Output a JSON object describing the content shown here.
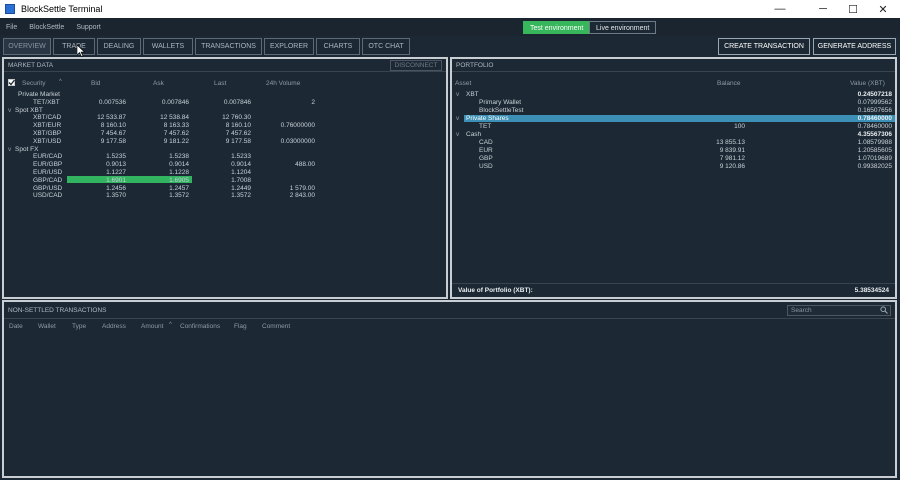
{
  "window": {
    "title": "BlockSettle Terminal",
    "min_glyph": "─",
    "max_glyph": "☐",
    "close_glyph": "✕",
    "dash_glyph": "—"
  },
  "menu": [
    "File",
    "BlockSettle",
    "Support"
  ],
  "environment": {
    "test": "Test environment",
    "live": "Live environment"
  },
  "tabs": [
    "OVERVIEW",
    "TRADE",
    "DEALING",
    "WALLETS",
    "TRANSACTIONS",
    "EXPLORER",
    "CHARTS",
    "OTC CHAT"
  ],
  "actions": {
    "create_tx": "CREATE TRANSACTION",
    "gen_addr": "GENERATE ADDRESS"
  },
  "market": {
    "title": "MARKET DATA",
    "disconnect": "DISCONNECT",
    "columns": {
      "security": "Security",
      "bid": "Bid",
      "ask": "Ask",
      "last": "Last",
      "vol": "24h Volume"
    },
    "groups": [
      {
        "name": "Private Market",
        "rows": [
          {
            "sec": "TET/XBT",
            "bid": "0.007536",
            "ask": "0.007846",
            "last": "0.007846",
            "vol": "2"
          }
        ]
      },
      {
        "name": "Spot XBT",
        "rows": [
          {
            "sec": "XBT/CAD",
            "bid": "12 533.87",
            "ask": "12 538.84",
            "last": "12 760.30",
            "vol": ""
          },
          {
            "sec": "XBT/EUR",
            "bid": "8 160.10",
            "ask": "8 163.33",
            "last": "8 160.10",
            "vol": "0.76000000"
          },
          {
            "sec": "XBT/GBP",
            "bid": "7 454.67",
            "ask": "7 457.62",
            "last": "7 457.62",
            "vol": ""
          },
          {
            "sec": "XBT/USD",
            "bid": "9 177.58",
            "ask": "9 181.22",
            "last": "9 177.58",
            "vol": "0.03000000"
          }
        ]
      },
      {
        "name": "Spot FX",
        "rows": [
          {
            "sec": "EUR/CAD",
            "bid": "1.5235",
            "ask": "1.5238",
            "last": "1.5233",
            "vol": ""
          },
          {
            "sec": "EUR/GBP",
            "bid": "0.9013",
            "ask": "0.9014",
            "last": "0.9014",
            "vol": "488.00"
          },
          {
            "sec": "EUR/USD",
            "bid": "1.1227",
            "ask": "1.1228",
            "last": "1.1204",
            "vol": ""
          },
          {
            "sec": "GBP/CAD",
            "bid": "1.6901",
            "ask": "1.6905",
            "last": "1.7008",
            "vol": ""
          },
          {
            "sec": "GBP/USD",
            "bid": "1.2456",
            "ask": "1.2457",
            "last": "1.2449",
            "vol": "1 579.00"
          },
          {
            "sec": "USD/CAD",
            "bid": "1.3570",
            "ask": "1.3572",
            "last": "1.3572",
            "vol": "2 843.00"
          }
        ]
      }
    ]
  },
  "portfolio": {
    "title": "PORTFOLIO",
    "columns": {
      "asset": "Asset",
      "balance": "Balance",
      "value": "Value (XBT)"
    },
    "rows": [
      {
        "label": "XBT",
        "indent": 1,
        "balance": "",
        "value": "0.24507218",
        "bold": true,
        "arrow": true
      },
      {
        "label": "Primary Wallet",
        "indent": 2,
        "balance": "",
        "value": "0.07999562"
      },
      {
        "label": "BlockSettleTest",
        "indent": 2,
        "balance": "",
        "value": "0.16507656"
      },
      {
        "label": "Private Shares",
        "indent": 1,
        "balance": "",
        "value": "0.78460000",
        "bold": true,
        "arrow": true,
        "selected": true
      },
      {
        "label": "TET",
        "indent": 2,
        "balance": "100",
        "value": "0.78460000"
      },
      {
        "label": "Cash",
        "indent": 1,
        "balance": "",
        "value": "4.35567306",
        "bold": true,
        "arrow": true
      },
      {
        "label": "CAD",
        "indent": 2,
        "balance": "13 855.13",
        "value": "1.08579988"
      },
      {
        "label": "EUR",
        "indent": 2,
        "balance": "9 839.91",
        "value": "1.20585605"
      },
      {
        "label": "GBP",
        "indent": 2,
        "balance": "7 981.12",
        "value": "1.07019689"
      },
      {
        "label": "USD",
        "indent": 2,
        "balance": "9 120.86",
        "value": "0.99382025"
      }
    ],
    "total_label": "Value of Portfolio (XBT):",
    "total_value": "5.38534524"
  },
  "nst": {
    "title": "NON-SETTLED TRANSACTIONS",
    "search_placeholder": "Search",
    "columns": [
      "Date",
      "Wallet",
      "Type",
      "Address",
      "Amount",
      "Confirmations",
      "Flag",
      "Comment"
    ]
  },
  "colors": {
    "accent_green": "#31b360",
    "selected_row": "#3c8fb5",
    "border": "#c9ced3"
  }
}
